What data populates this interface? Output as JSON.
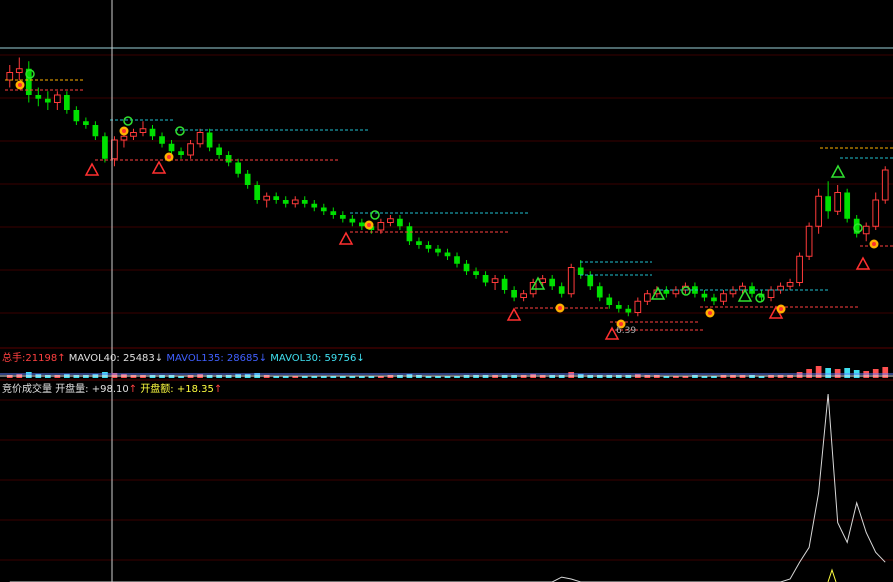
{
  "volume_bar": {
    "total_label": "总手:",
    "total_value": "21198",
    "total_arrow": "↑",
    "mavol40_label": "MAVOL40:",
    "mavol40_value": "25483",
    "mavol40_arrow": "↓",
    "mavol135_label": "MAVOL135:",
    "mavol135_value": "28685",
    "mavol135_arrow": "↓",
    "mavol30_label": "MAVOL30:",
    "mavol30_value": "59756",
    "mavol30_arrow": "↓"
  },
  "auction_panel": {
    "title": "竞价成交量",
    "open_vol_label": "开盘量:",
    "open_vol_value": "+98.10",
    "open_vol_arrow": "↑",
    "open_amt_label": "开盘额:",
    "open_amt_value": "+18.35",
    "open_amt_arrow": "↑"
  },
  "price_label": "6.39",
  "colors": {
    "background": "#000000",
    "up": "#ff3b3b",
    "down": "#00e000",
    "grid": "#3a0000",
    "cyan": "#00c8d8",
    "orange": "#ffb000",
    "white": "#e8e8e8",
    "dashed_red": "#ff4040",
    "dashed_cyan": "#20c0d0",
    "blue": "#4060ff",
    "yellow": "#ffff40"
  },
  "chart_data": {
    "type": "candlestick",
    "y_axis": "price",
    "candles": [
      [
        10.2,
        10.6,
        10.0,
        10.4
      ],
      [
        10.4,
        10.8,
        10.2,
        10.5
      ],
      [
        10.5,
        10.7,
        9.6,
        9.8
      ],
      [
        9.8,
        10.0,
        9.5,
        9.7
      ],
      [
        9.7,
        9.9,
        9.4,
        9.6
      ],
      [
        9.6,
        9.9,
        9.4,
        9.8
      ],
      [
        9.8,
        9.9,
        9.3,
        9.4
      ],
      [
        9.4,
        9.5,
        9.0,
        9.1
      ],
      [
        9.1,
        9.2,
        8.9,
        9.0
      ],
      [
        9.0,
        9.1,
        8.6,
        8.7
      ],
      [
        8.7,
        8.8,
        8.0,
        8.1
      ],
      [
        8.1,
        8.7,
        7.9,
        8.6
      ],
      [
        8.6,
        8.8,
        8.4,
        8.7
      ],
      [
        8.7,
        8.9,
        8.6,
        8.8
      ],
      [
        8.8,
        9.1,
        8.7,
        8.9
      ],
      [
        8.9,
        9.0,
        8.6,
        8.7
      ],
      [
        8.7,
        8.8,
        8.4,
        8.5
      ],
      [
        8.5,
        8.6,
        8.2,
        8.3
      ],
      [
        8.3,
        8.4,
        8.1,
        8.2
      ],
      [
        8.2,
        8.6,
        8.1,
        8.5
      ],
      [
        8.5,
        8.9,
        8.4,
        8.8
      ],
      [
        8.8,
        8.9,
        8.3,
        8.4
      ],
      [
        8.4,
        8.5,
        8.1,
        8.2
      ],
      [
        8.2,
        8.3,
        7.9,
        8.0
      ],
      [
        8.0,
        8.1,
        7.6,
        7.7
      ],
      [
        7.7,
        7.8,
        7.3,
        7.4
      ],
      [
        7.4,
        7.5,
        6.9,
        7.0
      ],
      [
        7.0,
        7.2,
        6.8,
        7.1
      ],
      [
        7.1,
        7.2,
        6.9,
        7.0
      ],
      [
        7.0,
        7.1,
        6.8,
        6.9
      ],
      [
        6.9,
        7.1,
        6.8,
        7.0
      ],
      [
        7.0,
        7.1,
        6.8,
        6.9
      ],
      [
        6.9,
        7.0,
        6.7,
        6.8
      ],
      [
        6.8,
        6.9,
        6.6,
        6.7
      ],
      [
        6.7,
        6.8,
        6.5,
        6.6
      ],
      [
        6.6,
        6.7,
        6.4,
        6.5
      ],
      [
        6.5,
        6.6,
        6.3,
        6.4
      ],
      [
        6.4,
        6.5,
        6.2,
        6.3
      ],
      [
        6.3,
        6.4,
        6.1,
        6.2
      ],
      [
        6.2,
        6.5,
        6.1,
        6.4
      ],
      [
        6.4,
        6.6,
        6.3,
        6.5
      ],
      [
        6.5,
        6.6,
        6.2,
        6.3
      ],
      [
        6.3,
        6.4,
        5.8,
        5.9
      ],
      [
        5.9,
        6.0,
        5.7,
        5.8
      ],
      [
        5.8,
        5.9,
        5.6,
        5.7
      ],
      [
        5.7,
        5.8,
        5.5,
        5.6
      ],
      [
        5.6,
        5.7,
        5.4,
        5.5
      ],
      [
        5.5,
        5.6,
        5.2,
        5.3
      ],
      [
        5.3,
        5.4,
        5.0,
        5.1
      ],
      [
        5.1,
        5.2,
        4.9,
        5.0
      ],
      [
        5.0,
        5.1,
        4.7,
        4.8
      ],
      [
        4.8,
        5.0,
        4.6,
        4.9
      ],
      [
        4.9,
        5.0,
        4.5,
        4.6
      ],
      [
        4.6,
        4.7,
        4.3,
        4.4
      ],
      [
        4.4,
        4.6,
        4.3,
        4.5
      ],
      [
        4.5,
        4.9,
        4.4,
        4.8
      ],
      [
        4.8,
        5.0,
        4.7,
        4.9
      ],
      [
        4.9,
        5.0,
        4.6,
        4.7
      ],
      [
        4.7,
        4.8,
        4.4,
        4.5
      ],
      [
        4.5,
        5.3,
        4.4,
        5.2
      ],
      [
        5.2,
        5.4,
        4.9,
        5.0
      ],
      [
        5.0,
        5.1,
        4.6,
        4.7
      ],
      [
        4.7,
        4.8,
        4.3,
        4.4
      ],
      [
        4.4,
        4.5,
        4.1,
        4.2
      ],
      [
        4.2,
        4.3,
        4.0,
        4.1
      ],
      [
        4.1,
        4.2,
        3.9,
        4.0
      ],
      [
        4.0,
        4.4,
        3.9,
        4.3
      ],
      [
        4.3,
        4.6,
        4.2,
        4.5
      ],
      [
        4.5,
        4.7,
        4.4,
        4.6
      ],
      [
        4.6,
        4.7,
        4.4,
        4.5
      ],
      [
        4.5,
        4.7,
        4.4,
        4.6
      ],
      [
        4.6,
        4.8,
        4.5,
        4.7
      ],
      [
        4.7,
        4.8,
        4.4,
        4.5
      ],
      [
        4.5,
        4.6,
        4.3,
        4.4
      ],
      [
        4.4,
        4.5,
        4.2,
        4.3
      ],
      [
        4.3,
        4.6,
        4.2,
        4.5
      ],
      [
        4.5,
        4.7,
        4.4,
        4.6
      ],
      [
        4.6,
        4.8,
        4.5,
        4.7
      ],
      [
        4.7,
        4.8,
        4.4,
        4.5
      ],
      [
        4.5,
        4.6,
        4.3,
        4.4
      ],
      [
        4.4,
        4.7,
        4.3,
        4.6
      ],
      [
        4.6,
        4.8,
        4.5,
        4.7
      ],
      [
        4.7,
        4.9,
        4.6,
        4.8
      ],
      [
        4.8,
        5.6,
        4.7,
        5.5
      ],
      [
        5.5,
        6.4,
        5.4,
        6.3
      ],
      [
        6.3,
        7.3,
        6.1,
        7.1
      ],
      [
        7.1,
        7.5,
        6.5,
        6.7
      ],
      [
        6.7,
        7.4,
        6.6,
        7.2
      ],
      [
        7.2,
        7.3,
        6.4,
        6.5
      ],
      [
        6.5,
        6.6,
        6.0,
        6.1
      ],
      [
        6.1,
        6.4,
        5.9,
        6.3
      ],
      [
        6.3,
        7.2,
        6.2,
        7.0
      ],
      [
        7.0,
        7.9,
        6.9,
        7.8
      ]
    ],
    "volume": [
      3,
      4,
      6,
      4,
      3,
      3,
      4,
      3,
      3,
      4,
      6,
      5,
      4,
      3,
      3,
      3,
      3,
      3,
      2,
      3,
      4,
      3,
      3,
      3,
      4,
      4,
      5,
      3,
      2,
      2,
      2,
      2,
      2,
      2,
      2,
      2,
      2,
      2,
      2,
      2,
      3,
      3,
      4,
      3,
      2,
      2,
      2,
      2,
      3,
      3,
      3,
      3,
      3,
      3,
      3,
      4,
      3,
      3,
      3,
      6,
      4,
      3,
      3,
      3,
      3,
      3,
      4,
      3,
      3,
      2,
      2,
      2,
      3,
      2,
      2,
      3,
      3,
      3,
      3,
      2,
      3,
      3,
      3,
      6,
      9,
      12,
      10,
      9,
      10,
      8,
      7,
      9,
      11
    ],
    "auction_volume": [
      0,
      0,
      0,
      0,
      0,
      0,
      0,
      0,
      0,
      0,
      0,
      0,
      0,
      0,
      0,
      0,
      0,
      0,
      0,
      0,
      0,
      0,
      0,
      0,
      0,
      0,
      0,
      0,
      0,
      0,
      0,
      0,
      0,
      0,
      0,
      0,
      0,
      0,
      0,
      0,
      0,
      0,
      0,
      0,
      0,
      0,
      0,
      0,
      0,
      0,
      0,
      0,
      0,
      0,
      0,
      0,
      0,
      0,
      5,
      3,
      0,
      0,
      0,
      0,
      0,
      0,
      0,
      0,
      0,
      0,
      0,
      0,
      0,
      0,
      0,
      0,
      0,
      0,
      0,
      0,
      0,
      0,
      3,
      20,
      35,
      90,
      190,
      60,
      40,
      80,
      50,
      30,
      20
    ]
  }
}
